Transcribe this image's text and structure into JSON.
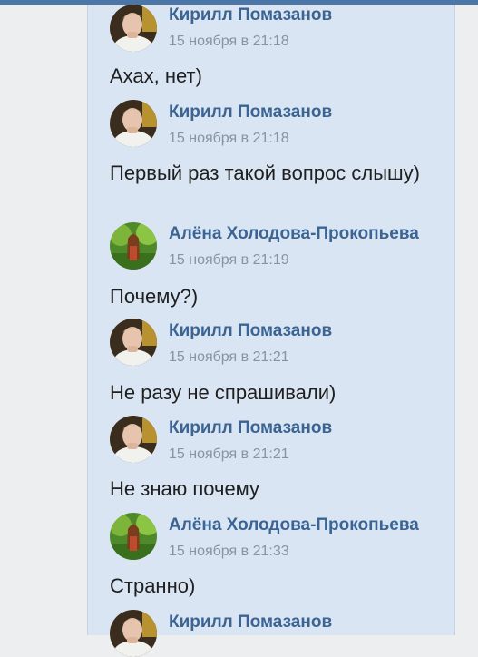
{
  "messages": [
    {
      "author": "Кирилл Помазанов",
      "time": "15 ноября в 21:18",
      "text": "Ахах, нет)",
      "avatar": "boy-photo"
    },
    {
      "author": "Кирилл Помазанов",
      "time": "15 ноября в 21:18",
      "text": "Первый раз такой вопрос слышу)",
      "avatar": "boy-photo"
    },
    {
      "author": "Алёна Холодова-Прокопьева",
      "time": "15 ноября в 21:19",
      "text": "Почему?)",
      "avatar": "forest-girl-photo"
    },
    {
      "author": "Кирилл Помазанов",
      "time": "15 ноября в 21:21",
      "text": "Не разу не спрашивали)",
      "avatar": "boy-photo"
    },
    {
      "author": "Кирилл Помазанов",
      "time": "15 ноября в 21:21",
      "text": "Не знаю почему",
      "avatar": "boy-photo"
    },
    {
      "author": "Алёна Холодова-Прокопьева",
      "time": "15 ноября в 21:33",
      "text": "Странно)",
      "avatar": "forest-girl-photo"
    },
    {
      "author": "Кирилл Помазанов",
      "time": "",
      "text": "",
      "avatar": "boy-photo"
    }
  ],
  "colors": {
    "thread_bg": "#d9e5f3",
    "author": "#3b6493",
    "time": "#8a93a0",
    "accent": "#4a76a8"
  }
}
